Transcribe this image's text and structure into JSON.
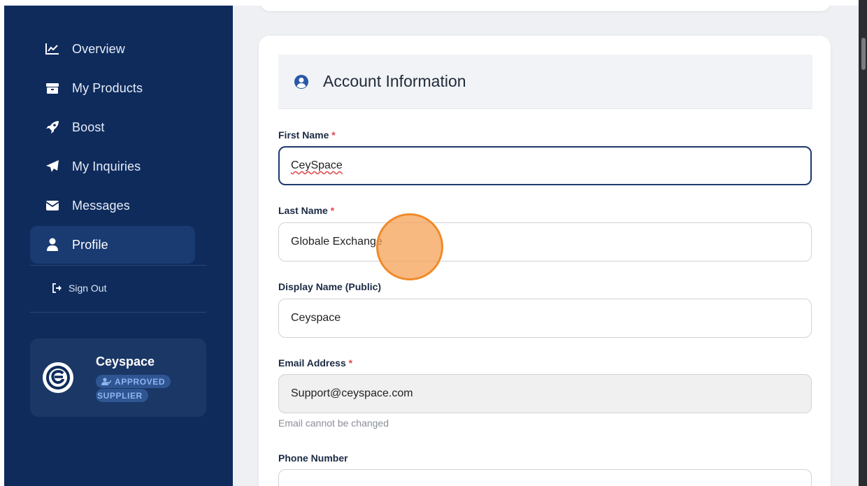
{
  "sidebar": {
    "items": [
      {
        "label": "Overview",
        "icon": "chart-line-icon"
      },
      {
        "label": "My Products",
        "icon": "box-icon"
      },
      {
        "label": "Boost",
        "icon": "rocket-icon"
      },
      {
        "label": "My Inquiries",
        "icon": "paper-plane-icon"
      },
      {
        "label": "Messages",
        "icon": "envelope-icon"
      },
      {
        "label": "Profile",
        "icon": "user-icon",
        "active": true
      }
    ],
    "signout_label": "Sign Out",
    "profile_card": {
      "name": "Ceyspace",
      "badge_line1": "APPROVED",
      "badge_line2": "SUPPLIER"
    }
  },
  "account": {
    "title": "Account Information",
    "first_name": {
      "label": "First Name",
      "required_mark": "*",
      "value": "CeySpace"
    },
    "last_name": {
      "label": "Last Name",
      "required_mark": "*",
      "value": "Globale Exchange"
    },
    "display_name": {
      "label": "Display Name (Public)",
      "value": "Ceyspace"
    },
    "email": {
      "label": "Email Address",
      "required_mark": "*",
      "value": "Support@ceyspace.com",
      "helper": "Email cannot be changed"
    },
    "phone": {
      "label": "Phone Number"
    }
  },
  "colors": {
    "sidebar_bg": "#0e2b5c",
    "active_item_bg": "#1a3a72",
    "accent": "#1e3a6e",
    "required": "#e2474b",
    "click_marker": "#f08a2a"
  }
}
